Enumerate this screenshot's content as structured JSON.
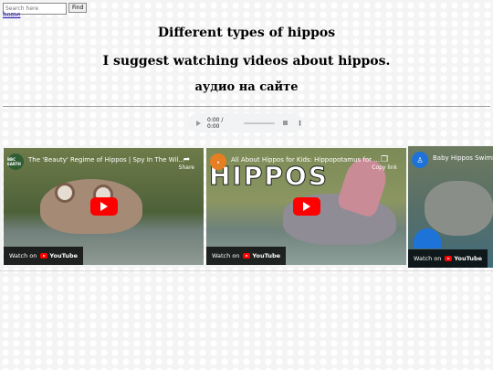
{
  "search": {
    "placeholder": "Search here",
    "button": "Find"
  },
  "nav": {
    "home": "home"
  },
  "headings": {
    "title": "Different types of hippos",
    "subtitle": "I suggest watching videos about hippos.",
    "audio_caption": "аудио на сайте"
  },
  "audio": {
    "time": "0:00 / 0:00",
    "more": "⋮"
  },
  "videos": [
    {
      "title": "The 'Beauty' Regime of Hippos | Spy In The Wil...",
      "channel_badge": "BBC EARTH",
      "action": "Share",
      "watch": "Watch on",
      "brand": "YouTube"
    },
    {
      "title": "All About Hippos for Kids: Hippopotamus for ...",
      "overlay_text": "HIPPOS",
      "action": "Copy link",
      "watch": "Watch on",
      "brand": "YouTube"
    },
    {
      "title": "Baby Hippos Swimm",
      "watch": "Watch on",
      "brand": "YouTube"
    }
  ],
  "colors": {
    "youtube_red": "#ff0000",
    "link": "#1a0dab"
  }
}
